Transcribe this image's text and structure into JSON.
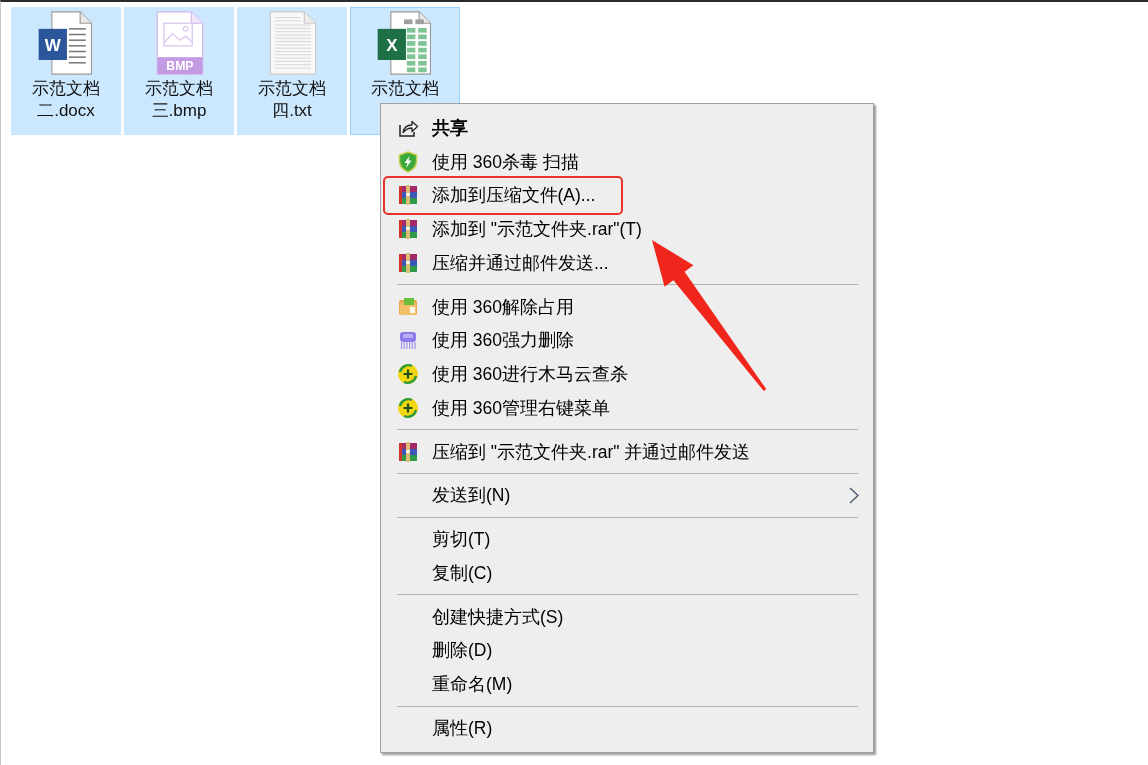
{
  "files": [
    {
      "name": "示范文档二.docx",
      "kind": "word",
      "badge": "W",
      "selected": true,
      "focused": false
    },
    {
      "name": "示范文档三.bmp",
      "kind": "image",
      "badge": "BMP",
      "selected": true,
      "focused": false
    },
    {
      "name": "示范文档四.txt",
      "kind": "text",
      "selected": true,
      "focused": false
    },
    {
      "name": "示范文档",
      "kind": "sheet",
      "badge": "X",
      "selected": true,
      "focused": true
    }
  ],
  "context_menu": {
    "groups": [
      {
        "items": [
          {
            "label": "共享",
            "kind": "share",
            "default": true,
            "highlighted": false,
            "submenu": false
          },
          {
            "label": "使用 360杀毒 扫描",
            "kind": "shield",
            "default": false,
            "highlighted": false,
            "submenu": false
          },
          {
            "label": "添加到压缩文件(A)...",
            "kind": "archive",
            "default": false,
            "highlighted": true,
            "submenu": false
          },
          {
            "label": "添加到 \"示范文件夹.rar\"(T)",
            "kind": "archive",
            "default": false,
            "highlighted": false,
            "submenu": false
          },
          {
            "label": "压缩并通过邮件发送...",
            "kind": "archive",
            "default": false,
            "highlighted": false,
            "submenu": false
          }
        ]
      },
      {
        "items": [
          {
            "label": "使用 360解除占用",
            "kind": "unlock",
            "default": false,
            "highlighted": false,
            "submenu": false
          },
          {
            "label": "使用 360强力删除",
            "kind": "shred",
            "default": false,
            "highlighted": false,
            "submenu": false
          },
          {
            "label": "使用 360进行木马云查杀",
            "kind": "scan",
            "default": false,
            "highlighted": false,
            "submenu": false
          },
          {
            "label": "使用 360管理右键菜单",
            "kind": "scan",
            "default": false,
            "highlighted": false,
            "submenu": false
          }
        ]
      },
      {
        "items": [
          {
            "label": "压缩到 \"示范文件夹.rar\" 并通过邮件发送",
            "kind": "archive",
            "default": false,
            "highlighted": false,
            "submenu": false
          }
        ]
      },
      {
        "items": [
          {
            "label": "发送到(N)",
            "kind": "plain",
            "default": false,
            "highlighted": false,
            "submenu": true
          }
        ]
      },
      {
        "items": [
          {
            "label": "剪切(T)",
            "kind": "plain",
            "default": false,
            "highlighted": false,
            "submenu": false
          },
          {
            "label": "复制(C)",
            "kind": "plain",
            "default": false,
            "highlighted": false,
            "submenu": false
          }
        ]
      },
      {
        "items": [
          {
            "label": "创建快捷方式(S)",
            "kind": "plain",
            "default": false,
            "highlighted": false,
            "submenu": false
          },
          {
            "label": "删除(D)",
            "kind": "plain",
            "default": false,
            "highlighted": false,
            "submenu": false
          },
          {
            "label": "重命名(M)",
            "kind": "plain",
            "default": false,
            "highlighted": false,
            "submenu": false
          }
        ]
      },
      {
        "items": [
          {
            "label": "属性(R)",
            "kind": "plain",
            "default": false,
            "highlighted": false,
            "submenu": false
          }
        ]
      }
    ]
  }
}
